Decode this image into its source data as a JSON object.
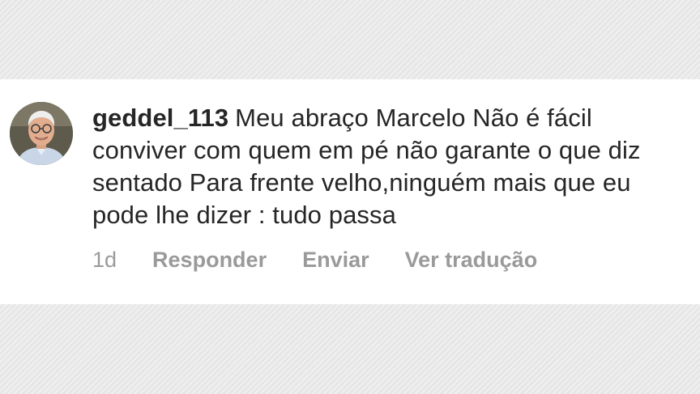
{
  "comment": {
    "username": "geddel_113",
    "text": "Meu abraço Marcelo Não é fácil conviver com quem em pé não garante o que diz sentado Para frente velho,ninguém mais que eu pode lhe dizer : tudo passa",
    "timestamp": "1d",
    "actions": {
      "reply": "Responder",
      "send": "Enviar",
      "translate": "Ver tradução"
    }
  },
  "avatar": {
    "icon": "user-avatar-photo"
  },
  "colors": {
    "text": "#262626",
    "secondary": "#9a9a9a",
    "card_bg": "#ffffff"
  }
}
